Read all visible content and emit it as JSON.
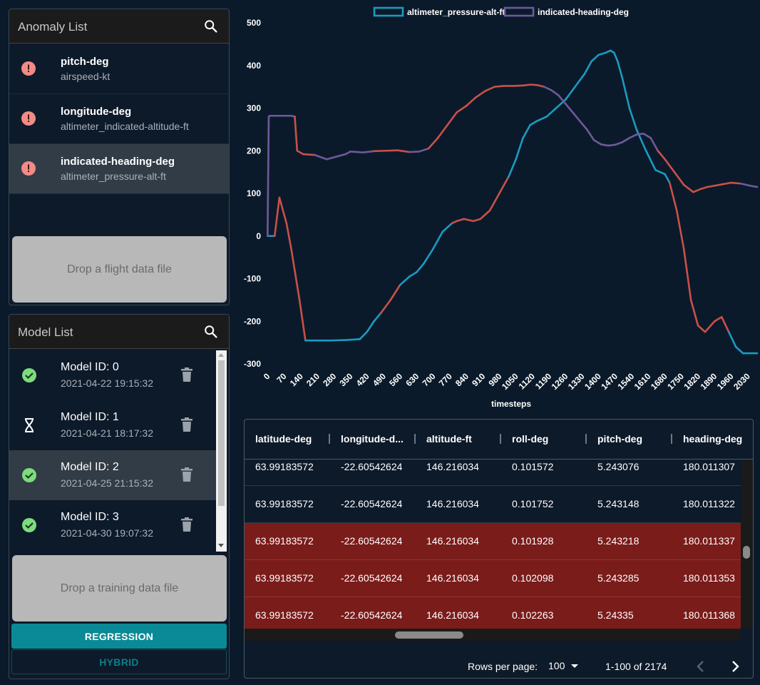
{
  "anomaly_list": {
    "title": "Anomaly List",
    "items": [
      {
        "primary": "pitch-deg",
        "secondary": "airspeed-kt",
        "selected": false
      },
      {
        "primary": "longitude-deg",
        "secondary": "altimeter_indicated-altitude-ft",
        "selected": false
      },
      {
        "primary": "indicated-heading-deg",
        "secondary": "altimeter_pressure-alt-ft",
        "selected": true
      }
    ],
    "dropzone_label": "Drop a flight data file"
  },
  "model_list": {
    "title": "Model List",
    "items": [
      {
        "primary": "Model ID: 0",
        "secondary": "2021-04-22 19:15:32",
        "status": "check-circle-icon",
        "selected": false
      },
      {
        "primary": "Model ID: 1",
        "secondary": "2021-04-21 18:17:32",
        "status": "hourglass-icon",
        "selected": false
      },
      {
        "primary": "Model ID: 2",
        "secondary": "2021-04-25 21:15:32",
        "status": "check-circle-icon",
        "selected": true
      },
      {
        "primary": "Model ID: 3",
        "secondary": "2021-04-30 19:07:32",
        "status": "check-circle-icon",
        "selected": false
      }
    ],
    "dropzone_label": "Drop a training data file"
  },
  "algorithm_buttons": {
    "regression_label": "REGRESSION",
    "hybrid_label": "HYBRID"
  },
  "colors": {
    "teal": "#1a9bc0",
    "purple": "#6e5a9a",
    "anomaly_red": "#c9504a",
    "check_green": "#7ddc7d",
    "error_red": "#f28b85"
  },
  "chart_data": {
    "type": "line",
    "xlabel": "timesteps",
    "ylabel": "",
    "ylim": [
      -300,
      500
    ],
    "y_ticks": [
      500,
      400,
      300,
      200,
      100,
      0,
      -100,
      -200,
      -300
    ],
    "x_ticks": [
      0,
      70,
      140,
      210,
      280,
      350,
      420,
      490,
      560,
      630,
      700,
      770,
      840,
      910,
      980,
      1050,
      1120,
      1190,
      1260,
      1330,
      1400,
      1470,
      1540,
      1610,
      1680,
      1750,
      1820,
      1890,
      1960,
      2030
    ],
    "xlim": [
      -10,
      2070
    ],
    "legend_position": "top",
    "series": [
      {
        "name": "altimeter_pressure-alt-ft",
        "color": "#1a9bc0",
        "x": [
          0,
          5,
          20,
          30,
          50,
          80,
          100,
          135,
          160,
          210,
          270,
          330,
          390,
          420,
          450,
          480,
          520,
          560,
          600,
          630,
          660,
          700,
          740,
          780,
          800,
          830,
          870,
          900,
          940,
          980,
          1020,
          1050,
          1080,
          1110,
          1140,
          1180,
          1220,
          1260,
          1300,
          1340,
          1370,
          1400,
          1430,
          1450,
          1465,
          1480,
          1500,
          1530,
          1560,
          1600,
          1640,
          1680,
          1700,
          1730,
          1760,
          1790,
          1820,
          1850,
          1890,
          1920,
          1950,
          1980,
          2010,
          2070
        ],
        "y": [
          0,
          0,
          0,
          0,
          90,
          30,
          -30,
          -150,
          -245,
          -245,
          -245,
          -244,
          -242,
          -225,
          -200,
          -180,
          -150,
          -115,
          -95,
          -85,
          -65,
          -30,
          10,
          30,
          35,
          40,
          35,
          40,
          60,
          100,
          140,
          180,
          230,
          260,
          270,
          280,
          300,
          320,
          350,
          380,
          410,
          425,
          430,
          435,
          430,
          410,
          370,
          300,
          250,
          200,
          155,
          145,
          125,
          60,
          -30,
          -150,
          -210,
          -225,
          -200,
          -190,
          -225,
          -260,
          -275,
          -275
        ],
        "anomaly_ranges": [
          [
            30,
            160
          ],
          [
            480,
            560
          ],
          [
            780,
            1000
          ],
          [
            1700,
            1940
          ]
        ]
      },
      {
        "name": "indicated-heading-deg",
        "color": "#6e5a9a",
        "x": [
          0,
          5,
          10,
          60,
          100,
          115,
          125,
          150,
          200,
          250,
          290,
          330,
          350,
          380,
          400,
          420,
          450,
          500,
          550,
          600,
          640,
          680,
          720,
          760,
          800,
          840,
          880,
          920,
          960,
          1000,
          1040,
          1080,
          1110,
          1140,
          1170,
          1200,
          1230,
          1260,
          1290,
          1320,
          1350,
          1380,
          1410,
          1440,
          1470,
          1500,
          1530,
          1560,
          1590,
          1620,
          1650,
          1680,
          1720,
          1760,
          1800,
          1830,
          1860,
          1890,
          1920,
          1960,
          2000,
          2040,
          2070
        ],
        "y": [
          0,
          280,
          282,
          282,
          282,
          280,
          200,
          192,
          190,
          180,
          186,
          192,
          198,
          197,
          196,
          197,
          199,
          200,
          201,
          197,
          198,
          205,
          230,
          260,
          290,
          305,
          325,
          340,
          350,
          352,
          352,
          353,
          355,
          354,
          350,
          342,
          330,
          310,
          290,
          270,
          250,
          225,
          215,
          212,
          214,
          220,
          230,
          238,
          240,
          230,
          200,
          180,
          150,
          120,
          103,
          110,
          115,
          118,
          121,
          125,
          123,
          118,
          115
        ],
        "anomaly_ranges": [
          [
            110,
            180
          ],
          [
            460,
            580
          ],
          [
            700,
            1160
          ],
          [
            1640,
            2000
          ]
        ]
      }
    ]
  },
  "data_table": {
    "columns": [
      "latitude-deg",
      "longitude-d...",
      "altitude-ft",
      "roll-deg",
      "pitch-deg",
      "heading-deg"
    ],
    "rows": [
      {
        "cells": [
          "63.99183572",
          "-22.60542624",
          "146.216034",
          "0.101572",
          "5.243076",
          "180.011307"
        ],
        "anomaly": false
      },
      {
        "cells": [
          "63.99183572",
          "-22.60542624",
          "146.216034",
          "0.101752",
          "5.243148",
          "180.011322"
        ],
        "anomaly": false
      },
      {
        "cells": [
          "63.99183572",
          "-22.60542624",
          "146.216034",
          "0.101928",
          "5.243218",
          "180.011337"
        ],
        "anomaly": true
      },
      {
        "cells": [
          "63.99183572",
          "-22.60542624",
          "146.216034",
          "0.102098",
          "5.243285",
          "180.011353"
        ],
        "anomaly": true
      },
      {
        "cells": [
          "63.99183572",
          "-22.60542624",
          "146.216034",
          "0.102263",
          "5.24335",
          "180.011368"
        ],
        "anomaly": true
      }
    ],
    "footer": {
      "rows_per_page_label": "Rows per page:",
      "rows_per_page_value": "100",
      "range_text": "1-100 of 2174"
    }
  }
}
